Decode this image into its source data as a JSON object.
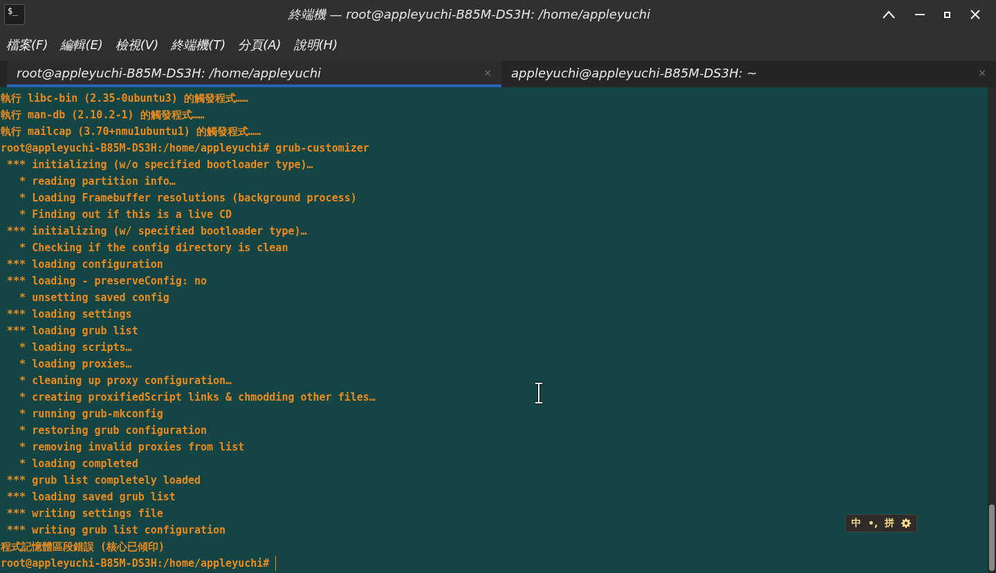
{
  "window": {
    "icon_text": "$_",
    "title": "終端機 — root@appleyuchi-B85M-DS3H: /home/appleyuchi"
  },
  "menu": [
    "檔案(F)",
    "編輯(E)",
    "檢視(V)",
    "終端機(T)",
    "分頁(A)",
    "說明(H)"
  ],
  "tabs": [
    {
      "label": "root@appleyuchi-B85M-DS3H: /home/appleyuchi",
      "selected": true,
      "close": "×"
    },
    {
      "label": "appleyuchi@appleyuchi-B85M-DS3H: ~",
      "selected": false,
      "close": "×"
    }
  ],
  "terminal": {
    "lines": [
      "執行 libc-bin (2.35-0ubuntu3) 的觸發程式……",
      "執行 man-db (2.10.2-1) 的觸發程式……",
      "執行 mailcap (3.70+nmu1ubuntu1) 的觸發程式……",
      "root@appleyuchi-B85M-DS3H:/home/appleyuchi# grub-customizer",
      " *** initializing (w/o specified bootloader type)…",
      "   * reading partition info…",
      "   * Loading Framebuffer resolutions (background process)",
      "   * Finding out if this is a live CD",
      " *** initializing (w/ specified bootloader type)…",
      "   * Checking if the config directory is clean",
      " *** loading configuration",
      " *** loading - preserveConfig: no",
      "   * unsetting saved config",
      " *** loading settings",
      " *** loading grub list",
      "   * loading scripts…",
      "   * loading proxies…",
      "   * cleaning up proxy configuration…",
      "   * creating proxifiedScript links & chmodding other files…",
      "   * running grub-mkconfig",
      "   * restoring grub configuration",
      "   * removing invalid proxies from list",
      "   * loading completed",
      " *** grub list completely loaded",
      " *** loading saved grub list",
      " *** writing settings file",
      " *** writing grub list configuration",
      "程式記憶體區段錯誤 (核心已傾印)"
    ],
    "prompt": "root@appleyuchi-B85M-DS3H:/home/appleyuchi#"
  },
  "ime_toolbar": {
    "items": [
      "中",
      "•,",
      "拼"
    ]
  }
}
